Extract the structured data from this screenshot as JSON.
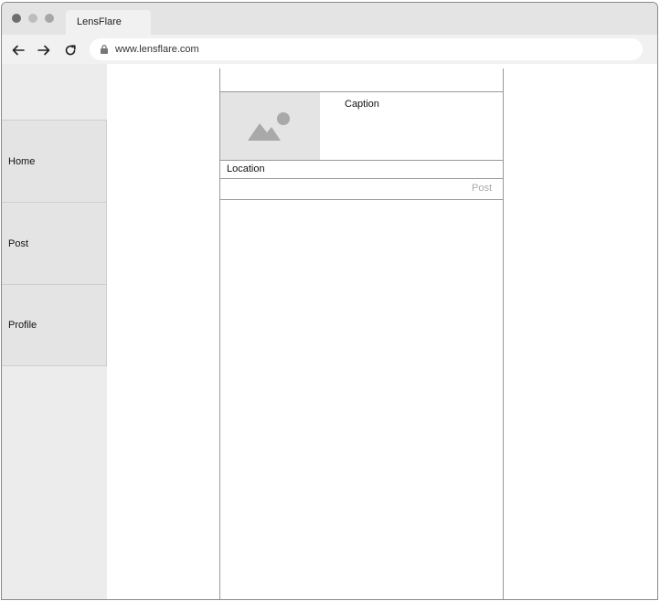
{
  "browser": {
    "tab_title": "LensFlare",
    "url": "www.lensflare.com"
  },
  "sidebar": {
    "items": [
      {
        "label": "Home"
      },
      {
        "label": "Post"
      },
      {
        "label": "Profile"
      }
    ]
  },
  "composer": {
    "image_icon": "image-icon",
    "caption_placeholder": "Caption",
    "location_placeholder": "Location",
    "post_label": "Post"
  },
  "colors": {
    "sidebar_bg": "#ececec",
    "post_button_text": "#a9a9a9"
  }
}
